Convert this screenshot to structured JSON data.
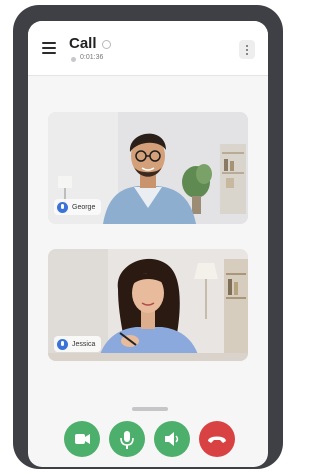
{
  "header": {
    "title": "Call",
    "timer": "0:01:36"
  },
  "participants": [
    {
      "name": "George"
    },
    {
      "name": "Jessica"
    }
  ],
  "controls": [
    {
      "icon": "video-camera-icon",
      "color": "#4caf6b"
    },
    {
      "icon": "microphone-icon",
      "color": "#4caf6b"
    },
    {
      "icon": "speaker-icon",
      "color": "#4caf6b"
    },
    {
      "icon": "end-call-icon",
      "color": "#d94242"
    }
  ]
}
